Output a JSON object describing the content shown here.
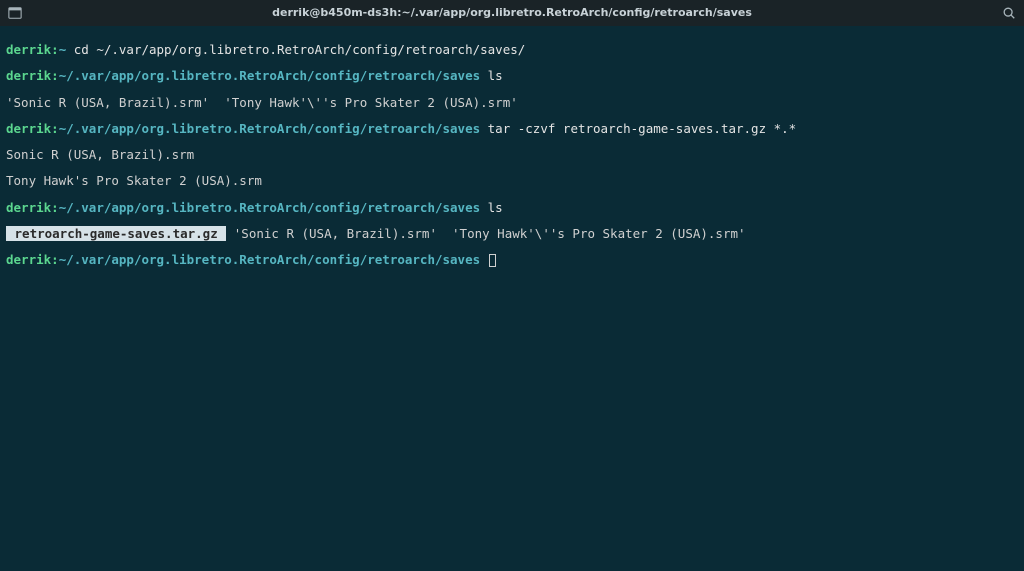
{
  "titlebar": {
    "title": "derrik@b450m-ds3h:~/.var/app/org.libretro.RetroArch/config/retroarch/saves"
  },
  "terminal": {
    "user": "derrik",
    "host_prompt_sep": ":",
    "home_prompt": "~",
    "saves_path": "~/.var/app/org.libretro.RetroArch/config/retroarch/saves",
    "cd_command": "cd ~/.var/app/org.libretro.RetroArch/config/retroarch/saves/",
    "ls_command": "ls",
    "ls_output_1": "'Sonic R (USA, Brazil).srm'  'Tony Hawk'\\''s Pro Skater 2 (USA).srm'",
    "tar_command": "tar -czvf retroarch-game-saves.tar.gz *.*",
    "tar_output_1": "Sonic R (USA, Brazil).srm",
    "tar_output_2": "Tony Hawk's Pro Skater 2 (USA).srm",
    "archive_name": " retroarch-game-saves.tar.gz ",
    "ls_output_2_rest": " 'Sonic R (USA, Brazil).srm'  'Tony Hawk'\\''s Pro Skater 2 (USA).srm'",
    "prompt_end": " "
  }
}
